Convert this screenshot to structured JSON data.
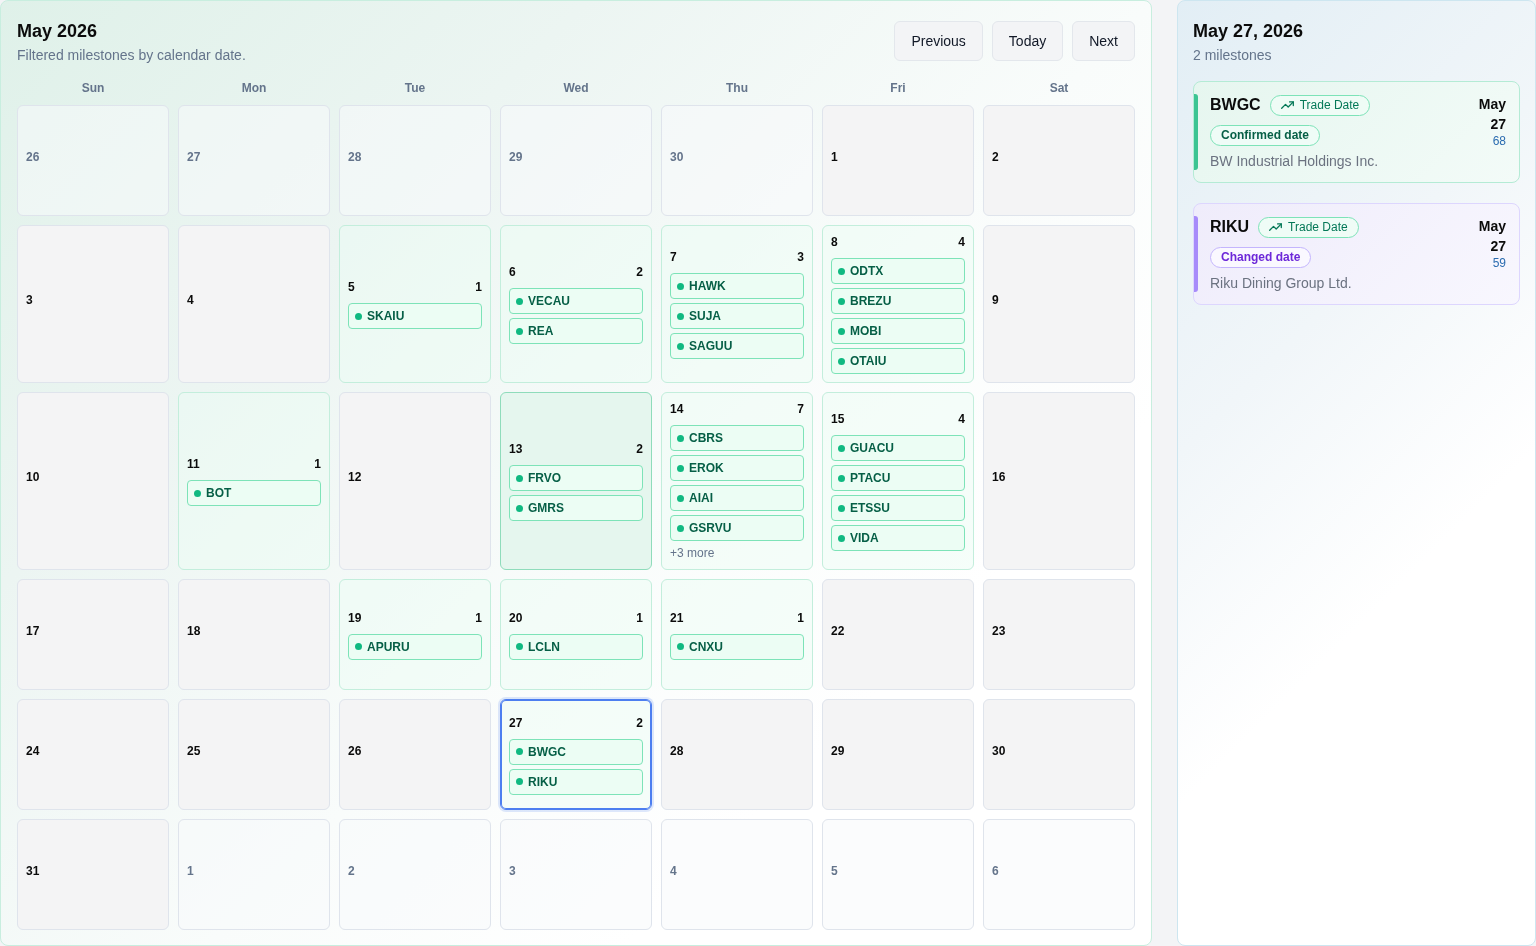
{
  "calendar": {
    "title": "May 2026",
    "subtitle": "Filtered milestones by calendar date.",
    "nav_buttons": [
      "Previous",
      "Today",
      "Next"
    ],
    "weekdays": [
      "Sun",
      "Mon",
      "Tue",
      "Wed",
      "Thu",
      "Fri",
      "Sat"
    ],
    "days": [
      {
        "day": "26",
        "in_month": false,
        "selected": false,
        "highlighted": false
      },
      {
        "day": "27",
        "in_month": false,
        "selected": false,
        "highlighted": false
      },
      {
        "day": "28",
        "in_month": false,
        "selected": false,
        "highlighted": false
      },
      {
        "day": "29",
        "in_month": false,
        "selected": false,
        "highlighted": false
      },
      {
        "day": "30",
        "in_month": false,
        "selected": false,
        "highlighted": false
      },
      {
        "day": "1",
        "in_month": true,
        "selected": false,
        "highlighted": false
      },
      {
        "day": "2",
        "in_month": true,
        "selected": false,
        "highlighted": false
      },
      {
        "day": "3",
        "in_month": true,
        "selected": false,
        "highlighted": false
      },
      {
        "day": "4",
        "in_month": true,
        "selected": false,
        "highlighted": false
      },
      {
        "day": "5",
        "in_month": true,
        "selected": false,
        "highlighted": false,
        "count": "1",
        "milestones": [
          "SKAIU"
        ]
      },
      {
        "day": "6",
        "in_month": true,
        "selected": false,
        "highlighted": false,
        "count": "2",
        "milestones": [
          "VECAU",
          "REA"
        ]
      },
      {
        "day": "7",
        "in_month": true,
        "selected": false,
        "highlighted": false,
        "count": "3",
        "milestones": [
          "HAWK",
          "SUJA",
          "SAGUU"
        ]
      },
      {
        "day": "8",
        "in_month": true,
        "selected": false,
        "highlighted": false,
        "count": "4",
        "milestones": [
          "ODTX",
          "BREZU",
          "MOBI",
          "OTAIU"
        ]
      },
      {
        "day": "9",
        "in_month": true,
        "selected": false,
        "highlighted": false
      },
      {
        "day": "10",
        "in_month": true,
        "selected": false,
        "highlighted": false
      },
      {
        "day": "11",
        "in_month": true,
        "selected": false,
        "highlighted": false,
        "count": "1",
        "milestones": [
          "BOT"
        ]
      },
      {
        "day": "12",
        "in_month": true,
        "selected": false,
        "highlighted": false
      },
      {
        "day": "13",
        "in_month": true,
        "selected": false,
        "highlighted": true,
        "count": "2",
        "milestones": [
          "FRVO",
          "GMRS"
        ]
      },
      {
        "day": "14",
        "in_month": true,
        "selected": false,
        "highlighted": false,
        "count": "7",
        "milestones": [
          "CBRS",
          "EROK",
          "AIAI",
          "GSRVU"
        ],
        "more": "+3 more"
      },
      {
        "day": "15",
        "in_month": true,
        "selected": false,
        "highlighted": false,
        "count": "4",
        "milestones": [
          "GUACU",
          "PTACU",
          "ETSSU",
          "VIDA"
        ]
      },
      {
        "day": "16",
        "in_month": true,
        "selected": false,
        "highlighted": false
      },
      {
        "day": "17",
        "in_month": true,
        "selected": false,
        "highlighted": false
      },
      {
        "day": "18",
        "in_month": true,
        "selected": false,
        "highlighted": false
      },
      {
        "day": "19",
        "in_month": true,
        "selected": false,
        "highlighted": false,
        "count": "1",
        "milestones": [
          "APURU"
        ]
      },
      {
        "day": "20",
        "in_month": true,
        "selected": false,
        "highlighted": false,
        "count": "1",
        "milestones": [
          "LCLN"
        ]
      },
      {
        "day": "21",
        "in_month": true,
        "selected": false,
        "highlighted": false,
        "count": "1",
        "milestones": [
          "CNXU"
        ]
      },
      {
        "day": "22",
        "in_month": true,
        "selected": false,
        "highlighted": false
      },
      {
        "day": "23",
        "in_month": true,
        "selected": false,
        "highlighted": false
      },
      {
        "day": "24",
        "in_month": true,
        "selected": false,
        "highlighted": false
      },
      {
        "day": "25",
        "in_month": true,
        "selected": false,
        "highlighted": false
      },
      {
        "day": "26",
        "in_month": true,
        "selected": false,
        "highlighted": false
      },
      {
        "day": "27",
        "in_month": true,
        "selected": true,
        "highlighted": false,
        "count": "2",
        "milestones": [
          "BWGC",
          "RIKU"
        ]
      },
      {
        "day": "28",
        "in_month": true,
        "selected": false,
        "highlighted": false
      },
      {
        "day": "29",
        "in_month": true,
        "selected": false,
        "highlighted": false
      },
      {
        "day": "30",
        "in_month": true,
        "selected": false,
        "highlighted": false
      },
      {
        "day": "31",
        "in_month": true,
        "selected": false,
        "highlighted": false
      },
      {
        "day": "1",
        "in_month": false,
        "selected": false,
        "highlighted": false
      },
      {
        "day": "2",
        "in_month": false,
        "selected": false,
        "highlighted": false
      },
      {
        "day": "3",
        "in_month": false,
        "selected": false,
        "highlighted": false
      },
      {
        "day": "4",
        "in_month": false,
        "selected": false,
        "highlighted": false
      },
      {
        "day": "5",
        "in_month": false,
        "selected": false,
        "highlighted": false
      },
      {
        "day": "6",
        "in_month": false,
        "selected": false,
        "highlighted": false
      }
    ]
  },
  "detail": {
    "title": "May 27, 2026",
    "subtitle": "2 milestones",
    "items": [
      {
        "ticker": "BWGC",
        "tag": "Trade Date",
        "status": "Confirmed date",
        "kind": "confirmed",
        "company": "BW Industrial Holdings Inc.",
        "month": "May",
        "day": "27",
        "number": "68"
      },
      {
        "ticker": "RIKU",
        "tag": "Trade Date",
        "status": "Changed date",
        "kind": "changed",
        "company": "Riku Dining Group Ltd.",
        "month": "May",
        "day": "27",
        "number": "59"
      }
    ]
  }
}
